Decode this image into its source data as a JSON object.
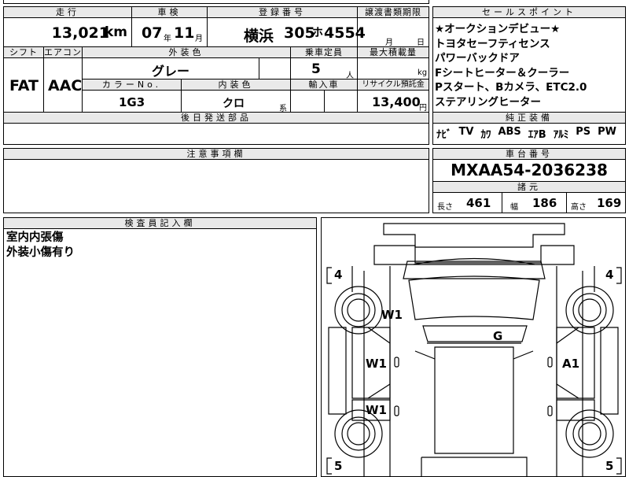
{
  "top_partial": {
    "a": "",
    "b": ""
  },
  "row1": {
    "h_mileage": "走行",
    "mileage": "13,021",
    "mileage_unit": "km",
    "h_inspection": "車検",
    "insp_year": "07",
    "insp_year_unit": "年",
    "insp_month": "11",
    "insp_month_unit": "月",
    "h_reg": "登録番号",
    "reg_area": "横浜",
    "reg_class": "305",
    "reg_kana": "ホ",
    "reg_number": "4554",
    "h_transfer": "譲渡書類期限",
    "transfer_month_unit": "月",
    "transfer_day_unit": "日"
  },
  "row2": {
    "h_shift": "シフト",
    "shift": "FAT",
    "h_ac": "エアコン",
    "ac": "AAC",
    "h_ext_color": "外装色",
    "ext_color": "グレー",
    "h_capacity": "乗車定員",
    "capacity": "5",
    "capacity_unit": "人",
    "h_load": "最大積載量",
    "load_unit": "kg",
    "h_color_no": "カラーNo.",
    "color_no": "1G3",
    "h_int_color": "内装色",
    "int_color": "クロ",
    "int_color_unit": "系",
    "h_import": "輸入車",
    "h_recycle": "リサイクル預託金",
    "recycle": "13,400",
    "recycle_unit": "円",
    "h_later_parts": "後日発送部品"
  },
  "sales_points": {
    "header": "セールスポイント",
    "lines": [
      "★オークションデビュー★",
      "トヨタセーフティセンス",
      "パワーバックドア",
      "Fシートヒーター＆クーラー",
      "Pスタート、Bカメラ、ETC2.0",
      "ステアリングヒーター"
    ]
  },
  "equipment": {
    "header": "純正装備",
    "items": [
      "ﾅﾋﾞ",
      "TV",
      "ｶﾜ",
      "ABS",
      "ｴｱB",
      "ｱﾙﾐ",
      "PS",
      "PW"
    ]
  },
  "notes": {
    "header": "注意事項欄"
  },
  "chassis": {
    "header": "車台番号",
    "number": "MXAA54-2036238"
  },
  "specs": {
    "header": "諸元",
    "length_label": "長さ",
    "length": "461",
    "width_label": "幅",
    "width": "186",
    "height_label": "高さ",
    "height": "169"
  },
  "inspector": {
    "header": "検査員記入欄",
    "lines": [
      "室内内張傷",
      "外装小傷有り"
    ]
  },
  "diagram": {
    "tire_fl": "4",
    "tire_fr": "4",
    "tire_rl": "5",
    "tire_rr": "5",
    "marks": [
      "W1",
      "G",
      "W1",
      "A1",
      "W1"
    ]
  }
}
